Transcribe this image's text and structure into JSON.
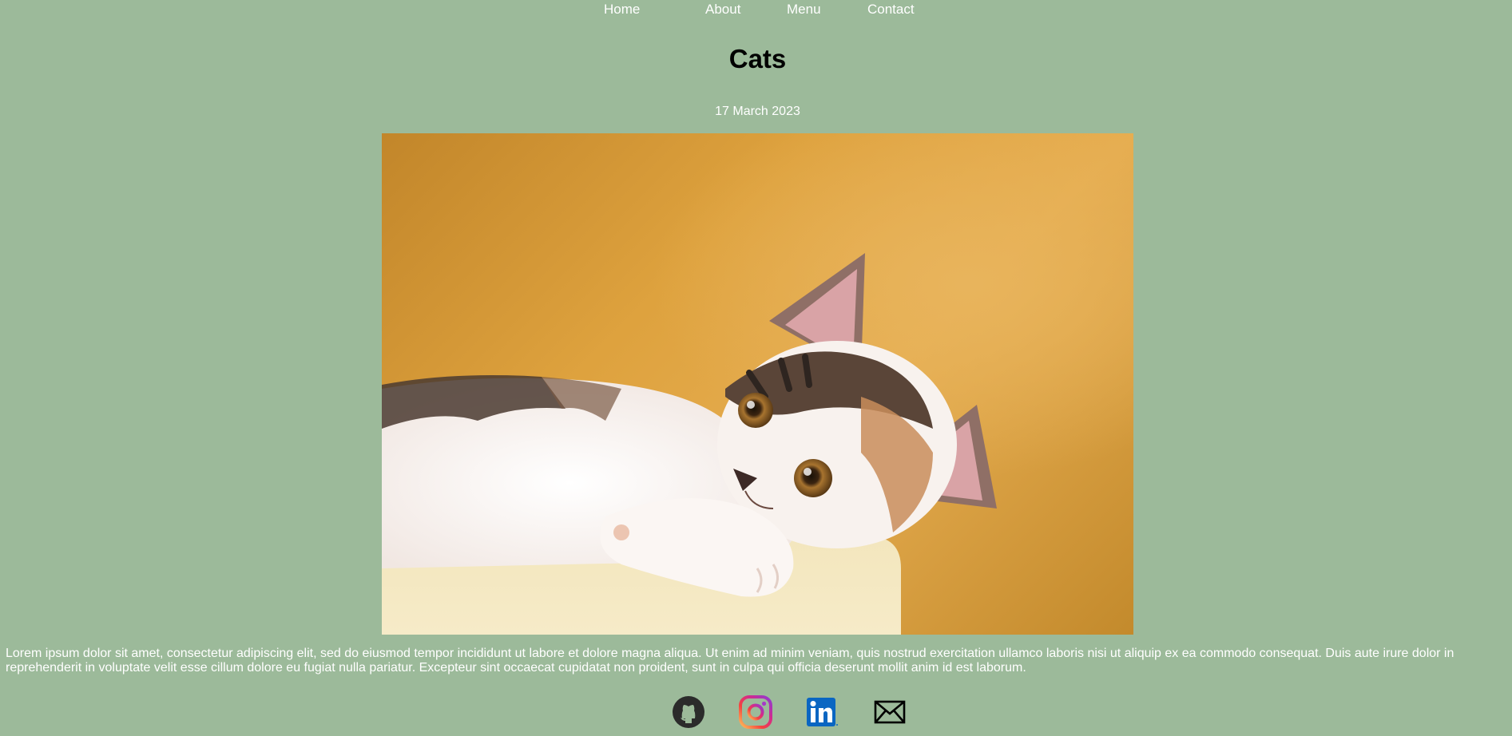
{
  "nav": {
    "items": [
      {
        "label": "Home"
      },
      {
        "label": "About"
      },
      {
        "label": "Menu"
      },
      {
        "label": "Contact"
      }
    ]
  },
  "article": {
    "title": "Cats",
    "date": "17 March 2023",
    "image_alt_subject": "kitten-photo",
    "body": "Lorem ipsum dolor sit amet, consectetur adipiscing elit, sed do eiusmod tempor incididunt ut labore et dolore magna aliqua. Ut enim ad minim veniam, quis nostrud exercitation ullamco laboris nisi ut aliquip ex ea commodo consequat. Duis aute irure dolor in reprehenderit in voluptate velit esse cillum dolore eu fugiat nulla pariatur. Excepteur sint occaecat cupidatat non proident, sunt in culpa qui officia deserunt mollit anim id est laborum."
  },
  "footer": {
    "social": [
      {
        "icon": "github-icon"
      },
      {
        "icon": "instagram-icon"
      },
      {
        "icon": "linkedin-icon"
      },
      {
        "icon": "email-icon"
      }
    ]
  },
  "colors": {
    "background": "#9cba9a",
    "text_light": "#ffffff",
    "title": "#000000",
    "photo_wall": "#dea23e",
    "linkedin_blue": "#0a66c2"
  }
}
